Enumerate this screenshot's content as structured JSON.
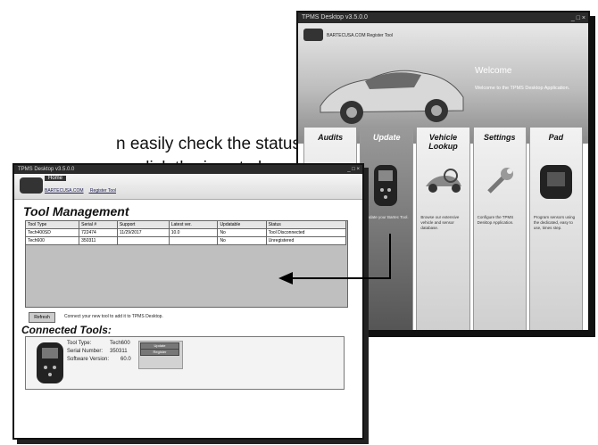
{
  "document": {
    "line1": "n easily check the status",
    "line2": "y click the icon to launch"
  },
  "welcome_window": {
    "title": "TPMS Desktop v3.5.0.0",
    "controls": "_ □ ×",
    "links": "BARTECUSA.COM   Register Tool",
    "welcome": "Welcome",
    "subtitle": "Welcome to the TPMS Desktop Application.",
    "cards": [
      {
        "title": "Audits",
        "desc": ""
      },
      {
        "title": "Update",
        "desc": "Update your Bartec Tool."
      },
      {
        "title": "Vehicle Lookup",
        "desc": "Browse our extensive vehicle and sensor database."
      },
      {
        "title": "Settings",
        "desc": "Configure the TPMS Desktop Application."
      },
      {
        "title": "Pad",
        "desc": "Program sensors using the dedicated, easy to use, times step."
      }
    ]
  },
  "tool_window": {
    "title": "TPMS Desktop v3.5.0.0",
    "controls": "_ □ ×",
    "home": "Home",
    "link_site": "BARTECUSA.COM",
    "link_register": "Register Tool",
    "heading": "Tool Management",
    "columns": [
      "Tool Type",
      "Serial #",
      "Support",
      "Latest ver.",
      "Updatable",
      "Status"
    ],
    "rows": [
      [
        "Tech400SD",
        "722474",
        "11/29/2017",
        "10.0",
        "No",
        "Tool Disconnected"
      ],
      [
        "Tech600",
        "350311",
        "",
        "",
        "No",
        "Unregistered"
      ]
    ],
    "refresh": "Refresh",
    "connect_message": "Connect your new tool to add it to TPMS Desktop.",
    "connected_heading": "Connected Tools:",
    "tool_type_label": "Tool Type:",
    "tool_type_value": "Tech600",
    "serial_label": "Serial Number:",
    "serial_value": "350311",
    "software_label": "Software Version:",
    "software_value": "60.0",
    "update_btn": "Update",
    "register_btn": "Register"
  }
}
